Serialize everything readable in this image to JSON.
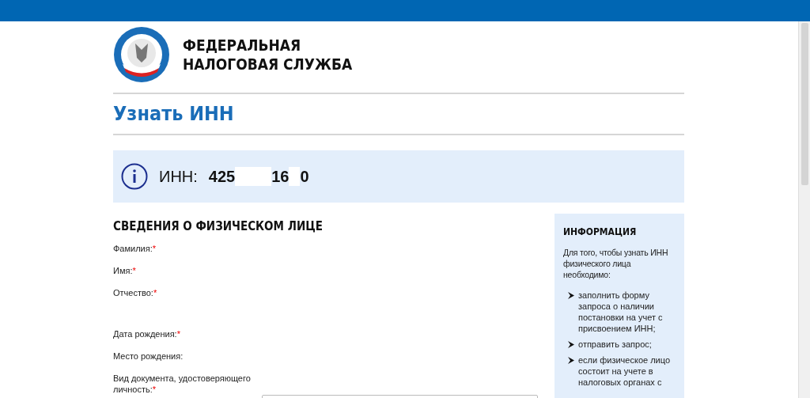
{
  "header": {
    "logo_lines": [
      "ФЕДЕРАЛЬНАЯ",
      "НАЛОГОВАЯ СЛУЖБА"
    ]
  },
  "page_title": "Узнать ИНН",
  "result": {
    "label": "ИНН:",
    "value_parts": [
      "425",
      "16",
      "0"
    ]
  },
  "form": {
    "heading": "СВЕДЕНИЯ О ФИЗИЧЕСКОМ ЛИЦЕ",
    "fields": [
      {
        "label": "Фамилия:",
        "required": true,
        "required_mark": "*"
      },
      {
        "label": "Имя:",
        "required": true,
        "required_mark": "*"
      },
      {
        "label": "Отчество:",
        "required": true,
        "required_mark": "*"
      },
      {
        "label": "Дата рождения:",
        "required": true,
        "required_mark": "*"
      },
      {
        "label": "Место рождения:"
      },
      {
        "label": "Вид документа, удостоверяющего личность:",
        "required": true,
        "required_mark": "*"
      }
    ]
  },
  "sidebar": {
    "heading": "ИНФОРМАЦИЯ",
    "intro": "Для того, чтобы узнать ИНН физического лица необходимо:",
    "items": [
      "заполнить форму запроса о наличии постановки на учет с присвоением ИНН;",
      "отправить запрос;",
      "если физическое лицо состоит на учете в налоговых органах с"
    ]
  }
}
